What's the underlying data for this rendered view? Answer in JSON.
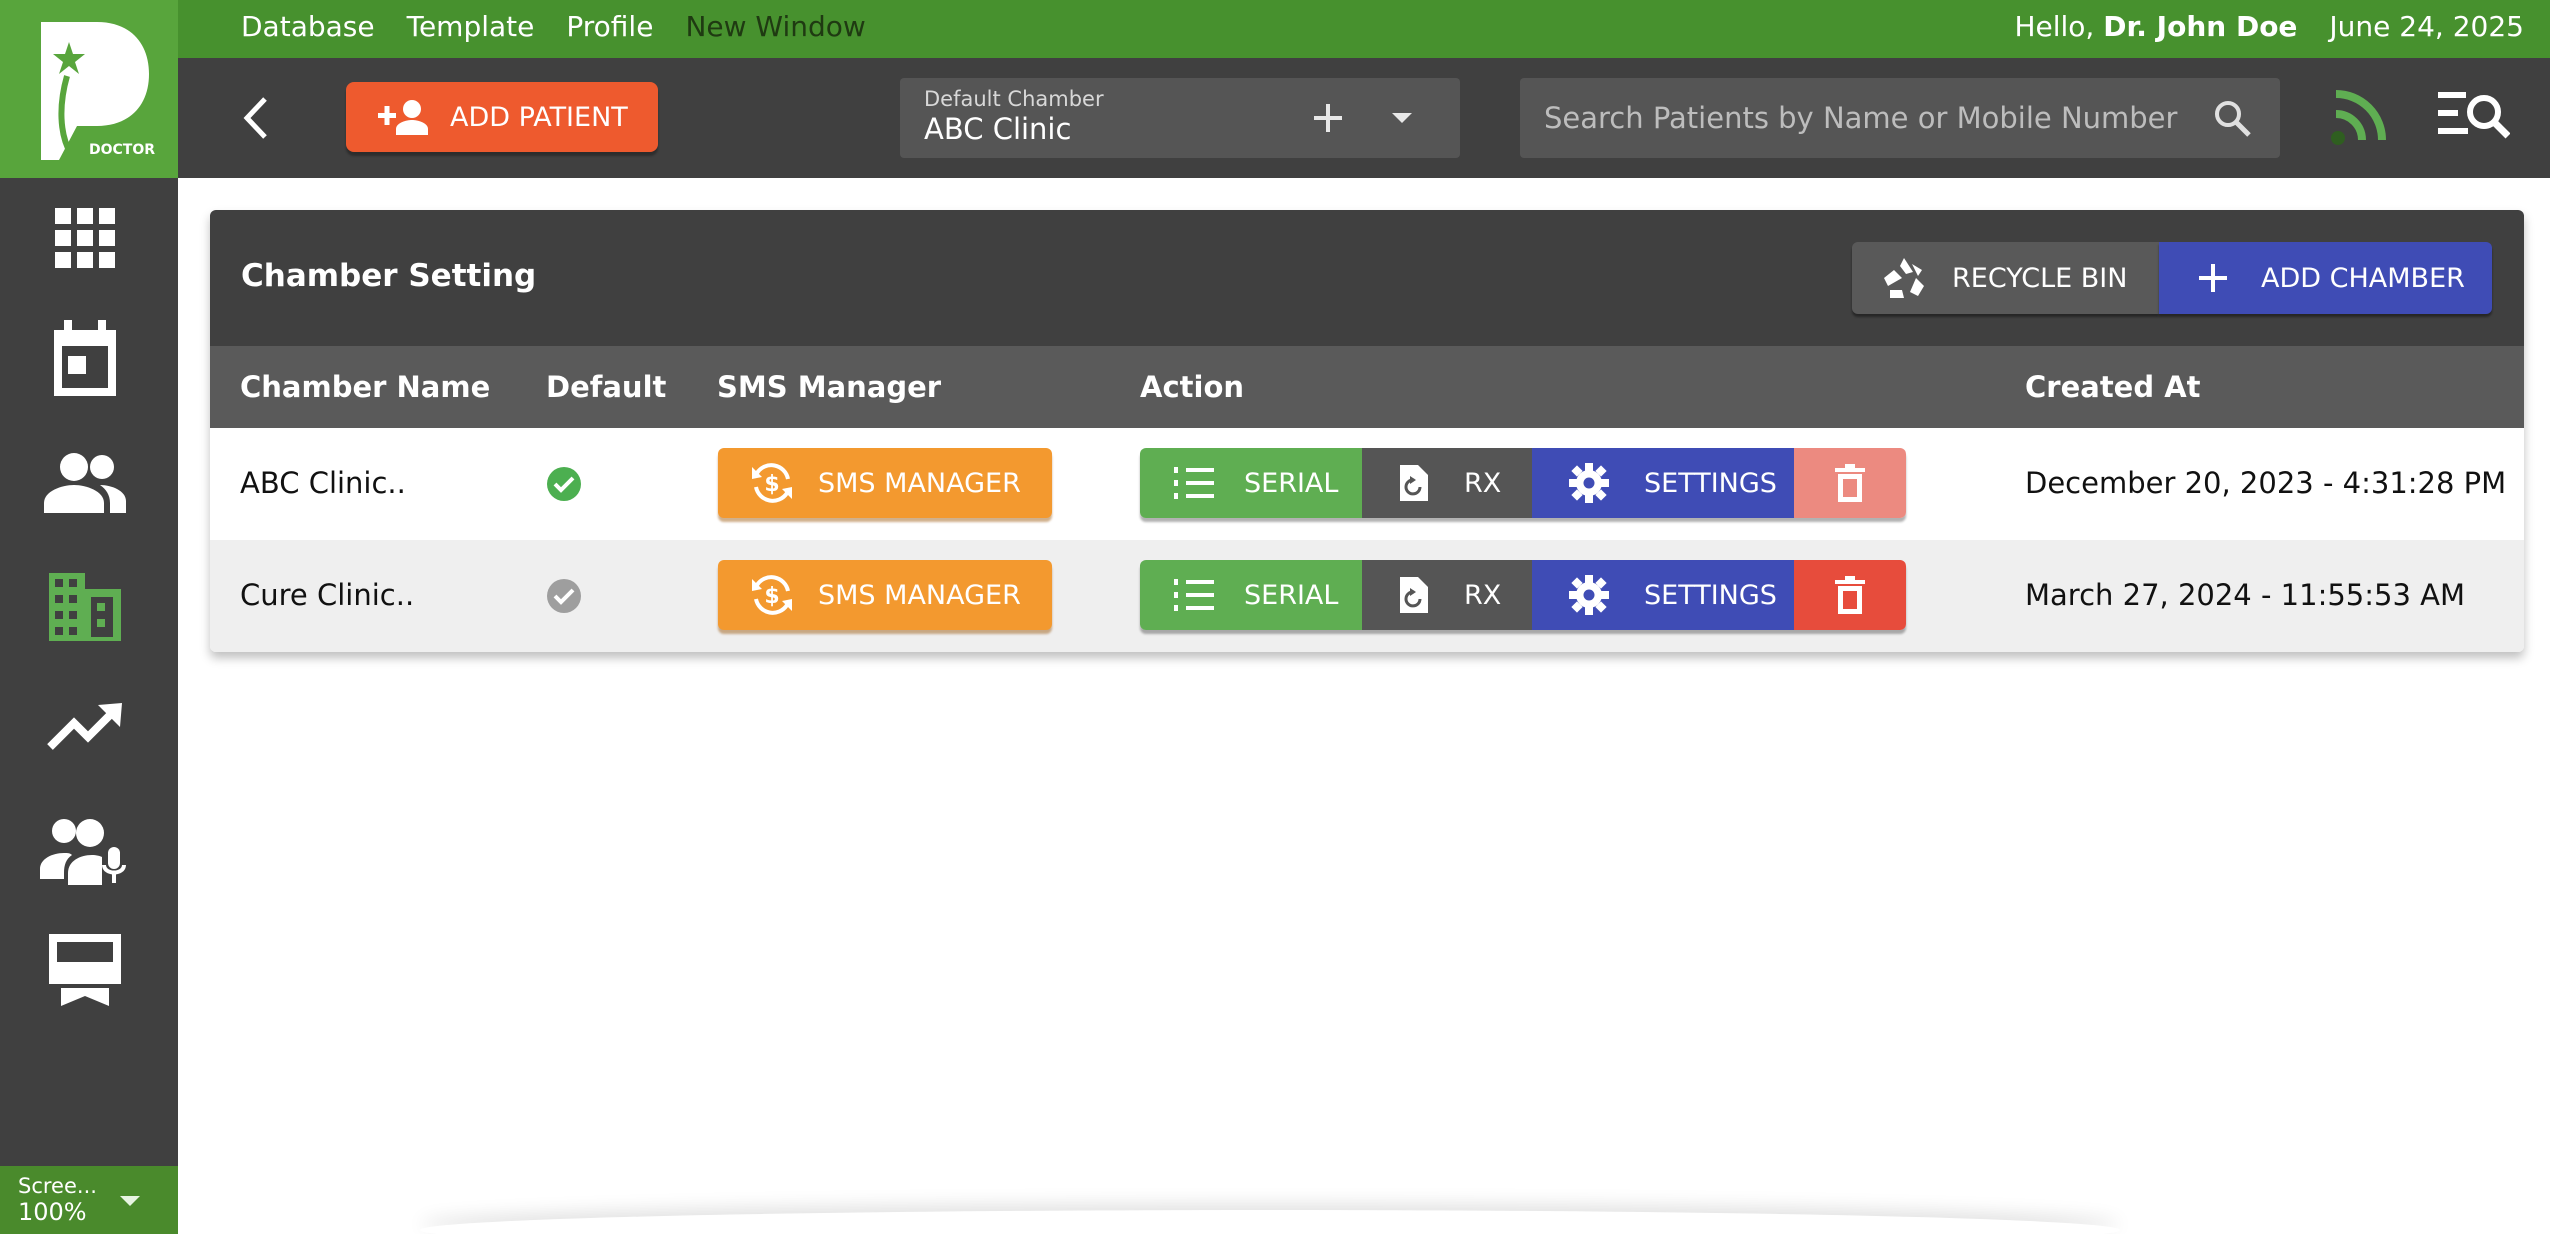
{
  "topbar": {
    "nav": [
      "Database",
      "Template",
      "Profile",
      "New Window"
    ],
    "greeting_prefix": "Hello,",
    "user_name": "Dr. John Doe",
    "date": "June 24, 2025"
  },
  "logo": {
    "letter": "P",
    "caption": "DOCTOR"
  },
  "sidebar": {
    "items": [
      "grid-icon",
      "calendar-icon",
      "people-icon",
      "building-icon",
      "trending-up-icon",
      "voice-users-icon",
      "kiosk-icon"
    ],
    "zoom_label": "Scree...",
    "zoom_value": "100%"
  },
  "header": {
    "add_patient_label": "ADD PATIENT",
    "chamber_label": "Default Chamber",
    "chamber_value": "ABC Clinic",
    "search_placeholder": "Search Patients by Name or Mobile Number"
  },
  "card": {
    "title": "Chamber Setting",
    "recycle_label": "RECYCLE BIN",
    "add_chamber_label": "ADD CHAMBER",
    "columns": [
      "Chamber Name",
      "Default",
      "SMS Manager",
      "Action",
      "Created At"
    ],
    "rows": [
      {
        "name": "ABC Clinic..",
        "is_default": true,
        "sms_label": "SMS MANAGER",
        "serial_label": "SERIAL",
        "rx_label": "RX",
        "settings_label": "SETTINGS",
        "created_at": "December 20, 2023 - 4:31:28 PM"
      },
      {
        "name": "Cure Clinic..",
        "is_default": false,
        "sms_label": "SMS MANAGER",
        "serial_label": "SERIAL",
        "rx_label": "RX",
        "settings_label": "SETTINGS",
        "created_at": "March 27, 2024 - 11:55:53 AM"
      }
    ]
  },
  "colors": {
    "topbar": "#47912e",
    "sidebar": "#404040",
    "add_patient": "#ee5a2e",
    "sms": "#f3992f",
    "serial": "#5fae52",
    "settings": "#3f4cb5",
    "delete": "#e74c3c",
    "default_check": "#4caf50"
  }
}
